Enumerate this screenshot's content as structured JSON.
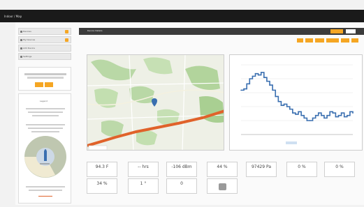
{
  "app": {
    "brand": "Indoor / Map",
    "user": ""
  },
  "sidebar": {
    "items": [
      {
        "label": "Devices",
        "icon": "device-icon"
      },
      {
        "label": "My Devices",
        "icon": "list-icon"
      },
      {
        "label": "Add Device",
        "icon": "plus-icon"
      },
      {
        "label": "Settings",
        "icon": "gear-icon"
      }
    ],
    "legend_title": "Legend"
  },
  "panel": {
    "title": "Device Details"
  },
  "chart_data": {
    "type": "line",
    "title": "",
    "xlabel": "",
    "ylabel": "",
    "x": [
      0,
      1,
      2,
      3,
      4,
      5,
      6,
      7,
      8,
      9,
      10,
      11,
      12,
      13,
      14,
      15,
      16,
      17,
      18,
      19,
      20,
      21,
      22,
      23,
      24,
      25,
      26,
      27,
      28,
      29,
      30,
      31,
      32,
      33,
      34,
      35,
      36,
      37,
      38,
      39
    ],
    "series": [
      {
        "name": "",
        "color": "#3a6fb0",
        "values": [
          70,
          72,
          80,
          88,
          92,
          96,
          94,
          98,
          90,
          84,
          78,
          70,
          60,
          52,
          46,
          48,
          44,
          40,
          34,
          32,
          36,
          30,
          26,
          22,
          22,
          26,
          30,
          34,
          30,
          26,
          30,
          36,
          34,
          28,
          30,
          34,
          28,
          30,
          36,
          34
        ]
      }
    ],
    "ylim": [
      0,
      110
    ]
  },
  "tiles": [
    {
      "value": "94.3 F",
      "sub": ""
    },
    {
      "value": "-- hrs",
      "sub": ""
    },
    {
      "value": "-106 dBm",
      "sub": ""
    },
    {
      "value": "44 %",
      "sub": ""
    },
    {
      "value": "97429 Pa",
      "sub": ""
    },
    {
      "value": "0 %",
      "sub": ""
    },
    {
      "value": "0 %",
      "sub": ""
    },
    {
      "value": "34 %",
      "sub": ""
    },
    {
      "value": "1 °",
      "sub": ""
    },
    {
      "value": "0",
      "sub": ""
    }
  ],
  "colors": {
    "accent": "#f5a623",
    "line": "#3a6fb0",
    "route": "#e0622a",
    "header": "#3b3b3b"
  }
}
